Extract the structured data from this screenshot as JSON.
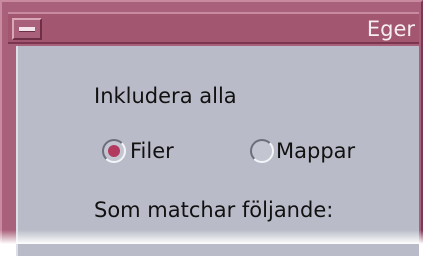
{
  "window": {
    "title": "Eger"
  },
  "dialog": {
    "include_label": "Inkludera alla",
    "options": [
      {
        "label": "Filer",
        "selected": true
      },
      {
        "label": "Mappar",
        "selected": false
      }
    ],
    "match_label": "Som matchar följande:"
  },
  "colors": {
    "titlebar": "#a3566f",
    "background": "#b9bcc8",
    "radio_selected": "#b23a5e"
  }
}
